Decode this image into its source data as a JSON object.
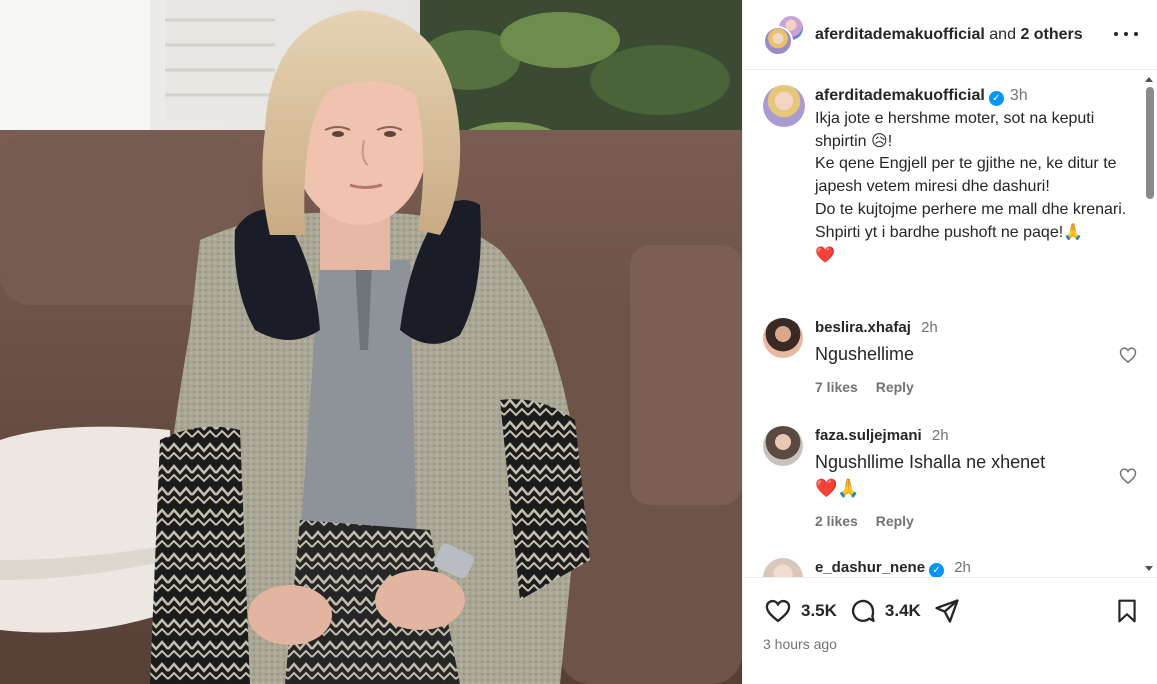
{
  "header": {
    "username": "aferditademakuofficial",
    "and_text": "and",
    "others_text": "2 others",
    "more_icon": "more-horizontal-icon"
  },
  "caption": {
    "username": "aferditademakuofficial",
    "time": "3h",
    "lines": [
      "Ikja jote e hershme moter, sot na keputi shpirtin 😥!",
      "Ke qene Engjell per te gjithe ne, ke ditur te japesh vetem miresi dhe dashuri!",
      "Do te kujtojme perhere me mall dhe krenari.",
      "Shpirti yt i bardhe pushoft ne paqe!🙏",
      "❤️"
    ]
  },
  "comments": [
    {
      "username": "beslira.xhafaj",
      "time": "2h",
      "text": "Ngushellime",
      "likes": "7 likes",
      "reply": "Reply",
      "verified": false
    },
    {
      "username": "faza.suljejmani",
      "time": "2h",
      "text": "Ngushllime Ishalla ne xhenet",
      "text2": "❤️🙏",
      "likes": "2 likes",
      "reply": "Reply",
      "verified": false
    },
    {
      "username": "e_dashur_nene",
      "time": "2h",
      "text": "",
      "likes": "",
      "reply": "",
      "verified": true
    }
  ],
  "actions": {
    "likes_count": "3.5K",
    "comments_count": "3.4K",
    "posted": "3 hours ago"
  },
  "colors": {
    "verified_blue": "#0095f6",
    "secondary_text": "#737373",
    "primary_text": "#262626"
  }
}
